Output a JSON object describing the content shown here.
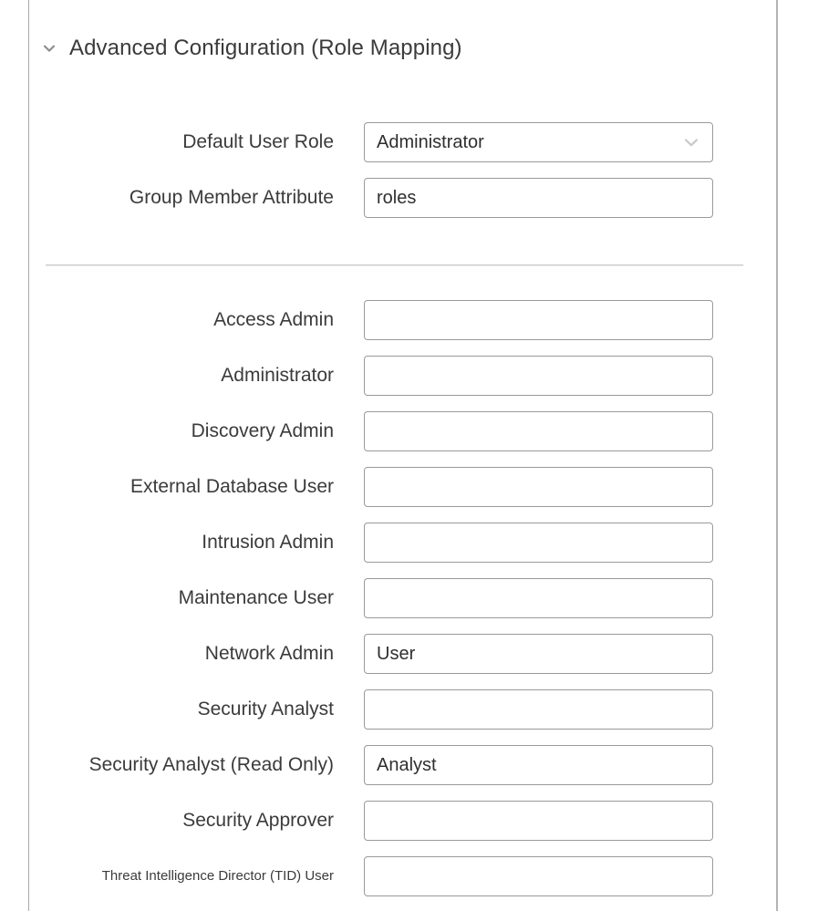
{
  "panel": {
    "section": {
      "title": "Advanced Configuration (Role Mapping)",
      "toggle_icon": "chevron-down-icon",
      "expanded": true
    },
    "general_fields": [
      {
        "label": "Default User Role",
        "type": "select",
        "value": "Administrator",
        "icon": "chevron-down-icon"
      },
      {
        "label": "Group Member Attribute",
        "type": "text",
        "value": "roles",
        "placeholder": ""
      }
    ],
    "role_mapping_fields": [
      {
        "label": "Access Admin",
        "value": "",
        "placeholder": ""
      },
      {
        "label": "Administrator",
        "value": "",
        "placeholder": ""
      },
      {
        "label": "Discovery Admin",
        "value": "",
        "placeholder": ""
      },
      {
        "label": "External Database User",
        "value": "",
        "placeholder": ""
      },
      {
        "label": "Intrusion Admin",
        "value": "",
        "placeholder": ""
      },
      {
        "label": "Maintenance User",
        "value": "",
        "placeholder": ""
      },
      {
        "label": "Network Admin",
        "value": "User",
        "placeholder": ""
      },
      {
        "label": "Security Analyst",
        "value": "",
        "placeholder": ""
      },
      {
        "label": "Security Analyst (Read Only)",
        "value": "Analyst",
        "placeholder": ""
      },
      {
        "label": "Security Approver",
        "value": "",
        "placeholder": ""
      },
      {
        "label": "Threat Intelligence Director (TID) User",
        "value": "",
        "placeholder": "",
        "label_size": "small"
      }
    ]
  },
  "colors": {
    "text": "#3b3b3b",
    "border": "#9a9a9a",
    "divider": "#c9cbcd",
    "panel_edge": "#a8a8a8",
    "background": "#ffffff",
    "chevron": "#8c8c8c",
    "select_chevron": "#c8c8c8"
  }
}
